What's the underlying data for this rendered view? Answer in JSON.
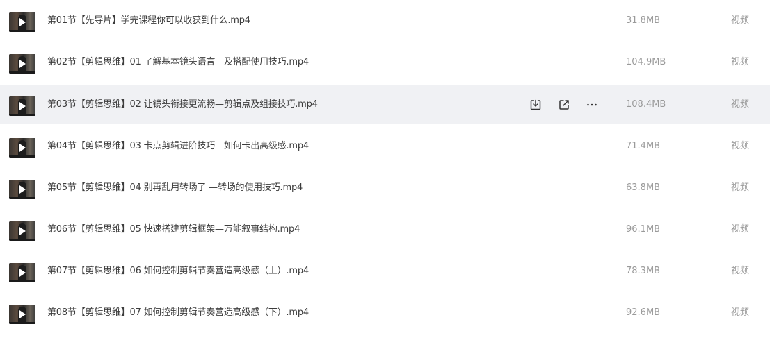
{
  "file_list": {
    "rows": [
      {
        "name": "第01节【先导片】学完课程你可以收获到什么.mp4",
        "size": "31.8MB",
        "type": "视频"
      },
      {
        "name": "第02节【剪辑思维】01 了解基本镜头语言—及搭配使用技巧.mp4",
        "size": "104.9MB",
        "type": "视频"
      },
      {
        "name": "第03节【剪辑思维】02 让镜头衔接更流畅—剪辑点及组接技巧.mp4",
        "size": "108.4MB",
        "type": "视频"
      },
      {
        "name": "第04节【剪辑思维】03 卡点剪辑进阶技巧—如何卡出高级感.mp4",
        "size": "71.4MB",
        "type": "视频"
      },
      {
        "name": "第05节【剪辑思维】04 别再乱用转场了 —转场的使用技巧.mp4",
        "size": "63.8MB",
        "type": "视频"
      },
      {
        "name": "第06节【剪辑思维】05 快速搭建剪辑框架—万能叙事结构.mp4",
        "size": "96.1MB",
        "type": "视频"
      },
      {
        "name": "第07节【剪辑思维】06 如何控制剪辑节奏营造高级感（上）.mp4",
        "size": "78.3MB",
        "type": "视频"
      },
      {
        "name": "第08节【剪辑思维】07 如何控制剪辑节奏营造高级感（下）.mp4",
        "size": "92.6MB",
        "type": "视频"
      }
    ],
    "hovered_row_actions": [
      "download-icon",
      "share-icon",
      "more-icon"
    ]
  },
  "colors": {
    "hover_background": "#f0f1f4",
    "name_text": "#3c3c3c",
    "meta_text": "#9a9a9a",
    "icon": "#333333"
  }
}
